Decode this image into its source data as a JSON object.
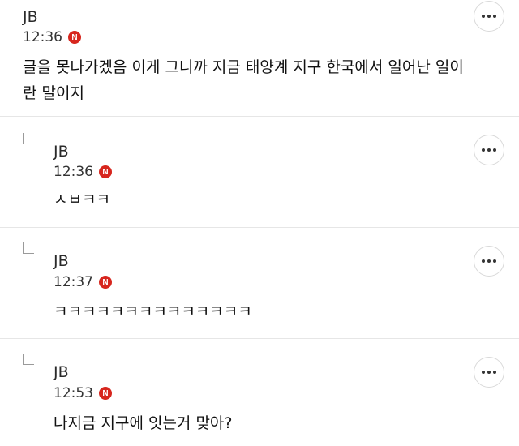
{
  "comments": [
    {
      "author": "JB",
      "time": "12:36",
      "badge": "N",
      "text_lines": [
        "글을 못나가겠음 이게 그니까 지금 태양계 지구 한국에서 일어난 일이",
        "란 말이지"
      ],
      "is_reply": false
    },
    {
      "author": "JB",
      "time": "12:36",
      "badge": "N",
      "text_lines": [
        "ㅅㅂㅋㅋ"
      ],
      "is_reply": true
    },
    {
      "author": "JB",
      "time": "12:37",
      "badge": "N",
      "text_lines": [
        "ㅋㅋㅋㅋㅋㅋㅋㅋㅋㅋㅋㅋㅋㅋ"
      ],
      "is_reply": true
    },
    {
      "author": "JB",
      "time": "12:53",
      "badge": "N",
      "text_lines": [
        "나지금 지구에 잇는거 맞아?"
      ],
      "is_reply": true
    }
  ],
  "colors": {
    "badge": "#d7261e",
    "divider": "#e6e6e6"
  },
  "icons": {
    "more": "more-dots-icon",
    "reply": "reply-arrow-icon",
    "new": "new-badge-icon"
  }
}
